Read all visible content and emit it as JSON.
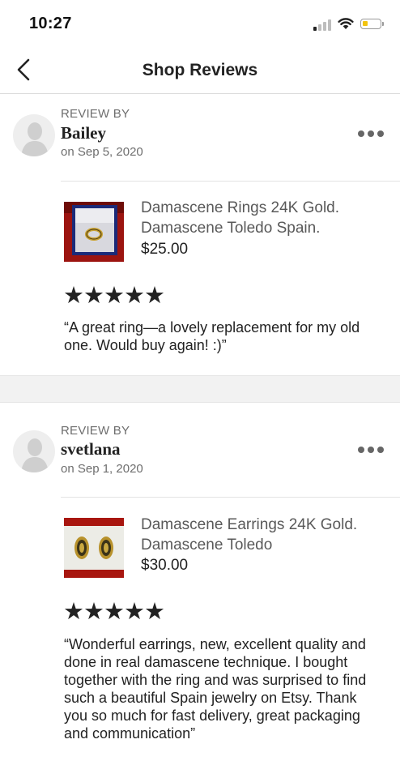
{
  "status_bar": {
    "time": "10:27",
    "signal_icon": "cellular-signal-icon",
    "wifi_icon": "wifi-icon",
    "battery_icon": "battery-low-icon",
    "battery_color": "#f2c40f"
  },
  "nav": {
    "title": "Shop Reviews",
    "back_icon": "chevron-left-icon"
  },
  "reviews": [
    {
      "by_label": "REVIEW BY",
      "reviewer": "Bailey",
      "date": "on Sep 5, 2020",
      "product_title": "Damascene Rings 24K Gold. Damascene Toledo Spain.",
      "price": "$25.00",
      "rating": 5,
      "stars": "★★★★★",
      "text": "“A great ring—a lovely replacement for my old one. Would buy again! :)”"
    },
    {
      "by_label": "REVIEW BY",
      "reviewer": "svetlana",
      "date": "on Sep 1, 2020",
      "product_title": "Damascene Earrings 24K Gold.  Damascene Toledo",
      "price": "$30.00",
      "rating": 5,
      "stars": "★★★★★",
      "text": "“Wonderful earrings, new, excellent quality and done in real damascene technique. I bought together with the ring and was surprised to find such a beautiful Spain jewelry on Etsy. Thank you so much for fast delivery, great packaging and communication”"
    }
  ]
}
